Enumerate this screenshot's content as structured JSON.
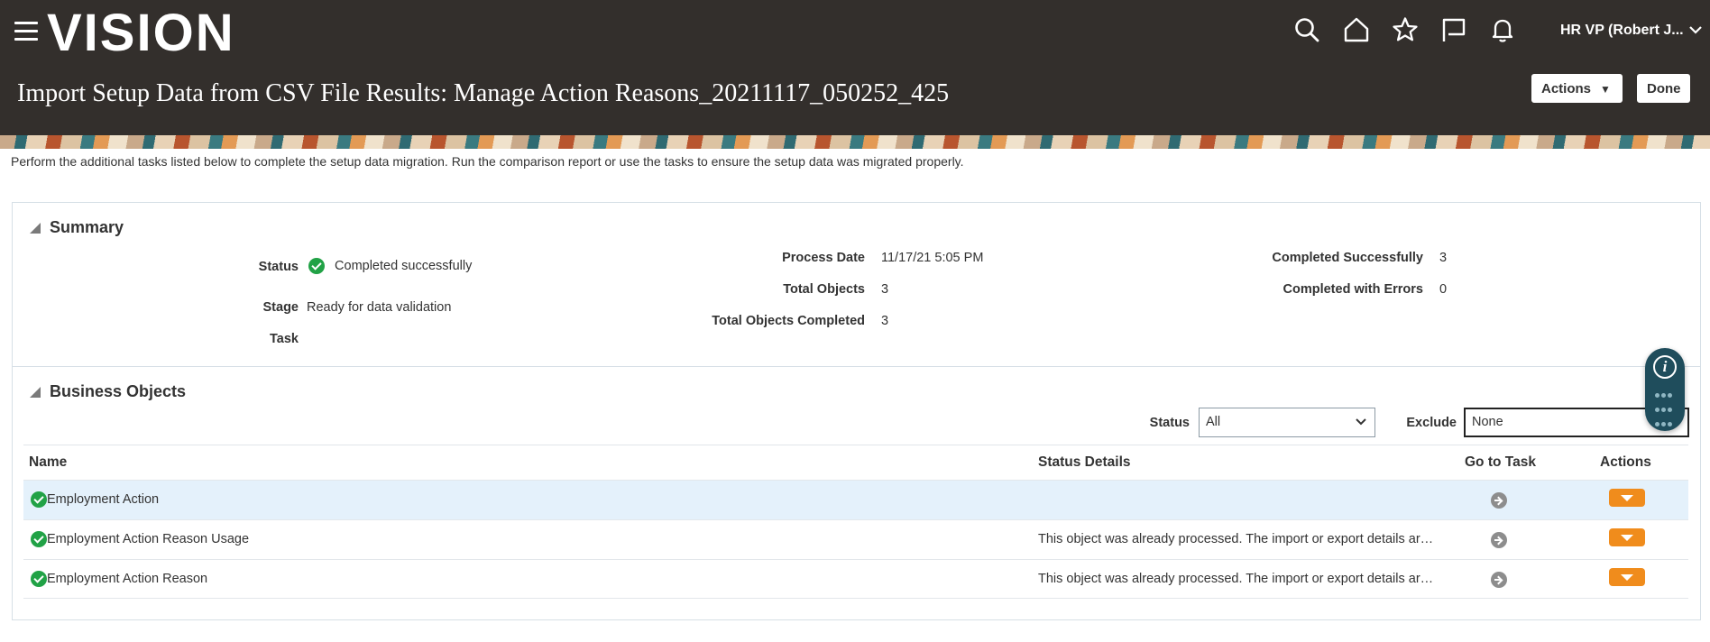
{
  "header": {
    "logo": "VISION",
    "user": "HR VP (Robert J...",
    "title": "Import Setup Data from CSV File Results: Manage Action Reasons_20211117_050252_425",
    "actions_label": "Actions",
    "done_label": "Done",
    "icons": [
      "search-icon",
      "home-icon",
      "star-icon",
      "flag-icon",
      "bell-icon"
    ]
  },
  "intro": "Perform the additional tasks listed below to complete the setup data migration. Run the comparison report or use the tasks to ensure the setup data was migrated properly.",
  "summary": {
    "title": "Summary",
    "status_label": "Status",
    "status_value": "Completed successfully",
    "stage_label": "Stage",
    "stage_value": "Ready for data validation",
    "task_label": "Task",
    "task_value": "",
    "process_date_label": "Process Date",
    "process_date_value": "11/17/21 5:05 PM",
    "total_objects_label": "Total Objects",
    "total_objects_value": "3",
    "total_completed_label": "Total Objects Completed",
    "total_completed_value": "3",
    "completed_success_label": "Completed Successfully",
    "completed_success_value": "3",
    "completed_errors_label": "Completed with Errors",
    "completed_errors_value": "0"
  },
  "business_objects": {
    "title": "Business Objects",
    "status_filter_label": "Status",
    "status_filter_value": "All",
    "exclude_label": "Exclude",
    "exclude_value": "None",
    "columns": {
      "name": "Name",
      "status_details": "Status Details",
      "go_to_task": "Go to Task",
      "actions": "Actions"
    },
    "rows": [
      {
        "name": "Employment Action",
        "details": ""
      },
      {
        "name": "Employment Action Reason Usage",
        "details": "This object was already processed. The import or export details are available."
      },
      {
        "name": "Employment Action Reason",
        "details": "This object was already processed. The import or export details are available."
      }
    ]
  },
  "colors": {
    "header_bg": "#332f2c",
    "success": "#21a246",
    "action_button": "#f08c1c",
    "selected_row": "#e4f1fb"
  }
}
